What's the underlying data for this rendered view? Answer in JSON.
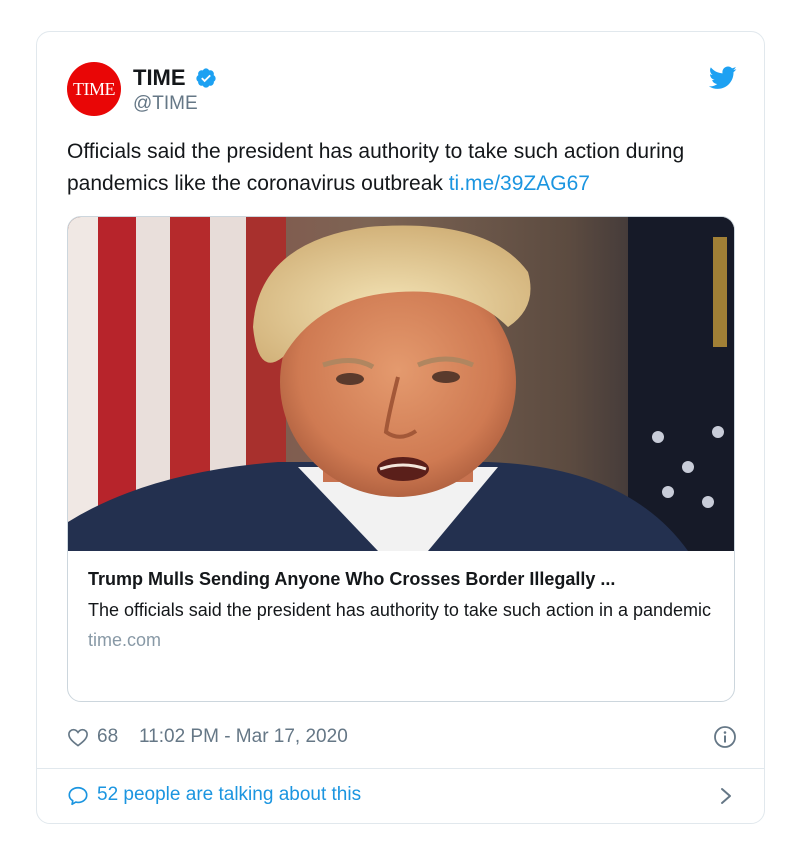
{
  "author": {
    "avatar_text": "TIME",
    "display_name": "TIME",
    "handle": "@TIME",
    "verified": true,
    "avatar_color": "#e90606"
  },
  "tweet": {
    "text": "Officials said the president has authority to take such action during pandemics like the coronavirus outbreak",
    "link": "ti.me/39ZAG67"
  },
  "link_card": {
    "title": "Trump Mulls Sending Anyone Who Crosses Border Illegally ...",
    "description": "The officials said the president has authority to take such action in a pandemic",
    "domain": "time.com"
  },
  "meta": {
    "likes": "68",
    "timestamp": "11:02 PM - Mar 17, 2020"
  },
  "conversation": {
    "label": "52 people are talking about this"
  },
  "colors": {
    "twitter_blue": "#1b95e0",
    "border": "#e1e8ed",
    "muted": "#657786"
  },
  "icons": {
    "verified": "verified-badge-icon",
    "brand": "twitter-bird-icon",
    "like": "heart-icon",
    "info": "info-icon",
    "reply": "speech-bubble-icon",
    "chevron": "chevron-right-icon"
  }
}
